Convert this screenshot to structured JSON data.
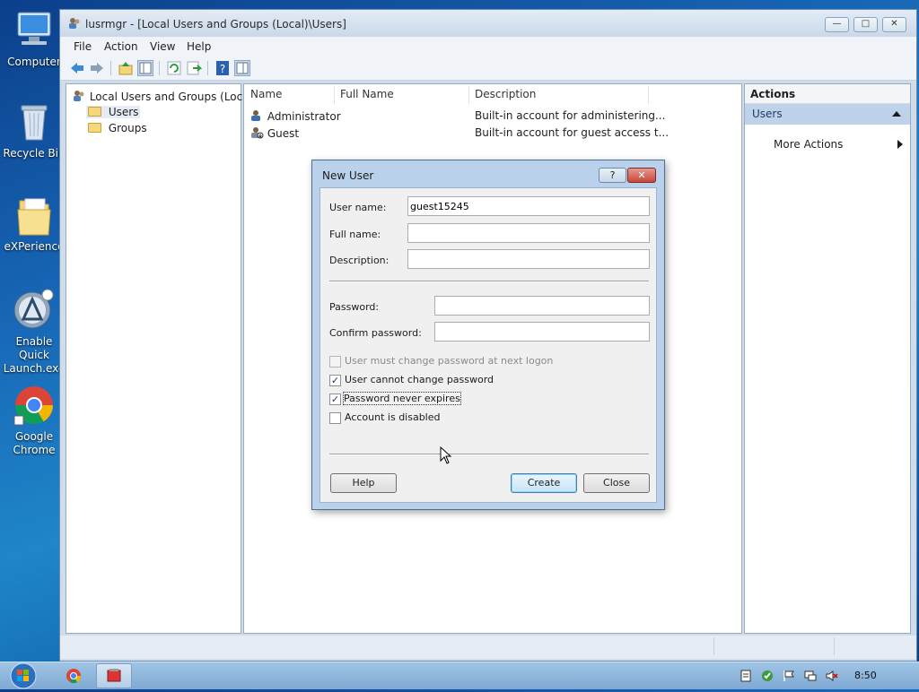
{
  "desktop": {
    "icons": [
      {
        "label": "Computer",
        "icon": "computer-icon"
      },
      {
        "label": "Recycle Bin",
        "icon": "recycle-bin-icon"
      },
      {
        "label": "eXPerience",
        "icon": "folder-icon"
      },
      {
        "label": "Enable Quick\nLaunch.exe",
        "icon": "quick-launch-icon"
      },
      {
        "label": "Google\nChrome",
        "icon": "chrome-icon"
      }
    ]
  },
  "window": {
    "title": "lusrmgr - [Local Users and Groups (Local)\\Users]",
    "controls": {
      "minimize": "—",
      "maximize": "□",
      "close": "✕"
    },
    "menu": [
      "File",
      "Action",
      "View",
      "Help"
    ],
    "toolbar": [
      "back-icon",
      "forward-icon",
      "up-folder-icon",
      "show-hide-tree-icon",
      "refresh-icon",
      "export-list-icon",
      "help-icon",
      "action-pane-icon"
    ]
  },
  "tree": {
    "root": "Local Users and Groups (Local)",
    "children": [
      "Users",
      "Groups"
    ]
  },
  "list": {
    "columns": [
      "Name",
      "Full Name",
      "Description"
    ],
    "rows": [
      {
        "name": "Administrator",
        "full_name": "",
        "description": "Built-in account for administering..."
      },
      {
        "name": "Guest",
        "full_name": "",
        "description": "Built-in account for guest access t..."
      }
    ]
  },
  "actions": {
    "header": "Actions",
    "section": "Users",
    "items": [
      "More Actions"
    ]
  },
  "dialog": {
    "title": "New User",
    "help_glyph": "?",
    "close_glyph": "✕",
    "fields": {
      "user_name_label": "User name:",
      "user_name_value": "guest15245",
      "full_name_label": "Full name:",
      "full_name_value": "",
      "description_label": "Description:",
      "description_value": "",
      "password_label": "Password:",
      "password_value": "",
      "confirm_label": "Confirm password:",
      "confirm_value": ""
    },
    "checkboxes": [
      {
        "label": "User must change password at next logon",
        "checked": false,
        "disabled": true
      },
      {
        "label": "User cannot change password",
        "checked": true,
        "disabled": false
      },
      {
        "label": "Password never expires",
        "checked": true,
        "disabled": false
      },
      {
        "label": "Account is disabled",
        "checked": false,
        "disabled": false
      }
    ],
    "buttons": {
      "help": "Help",
      "create": "Create",
      "close": "Close"
    }
  },
  "taskbar": {
    "clock": "8:50",
    "pinned": [
      "chrome-icon",
      "lusrmgr-icon"
    ],
    "tray": [
      "notes-icon",
      "security-icon",
      "flag-icon",
      "network-icon",
      "volume-muted-icon"
    ]
  }
}
